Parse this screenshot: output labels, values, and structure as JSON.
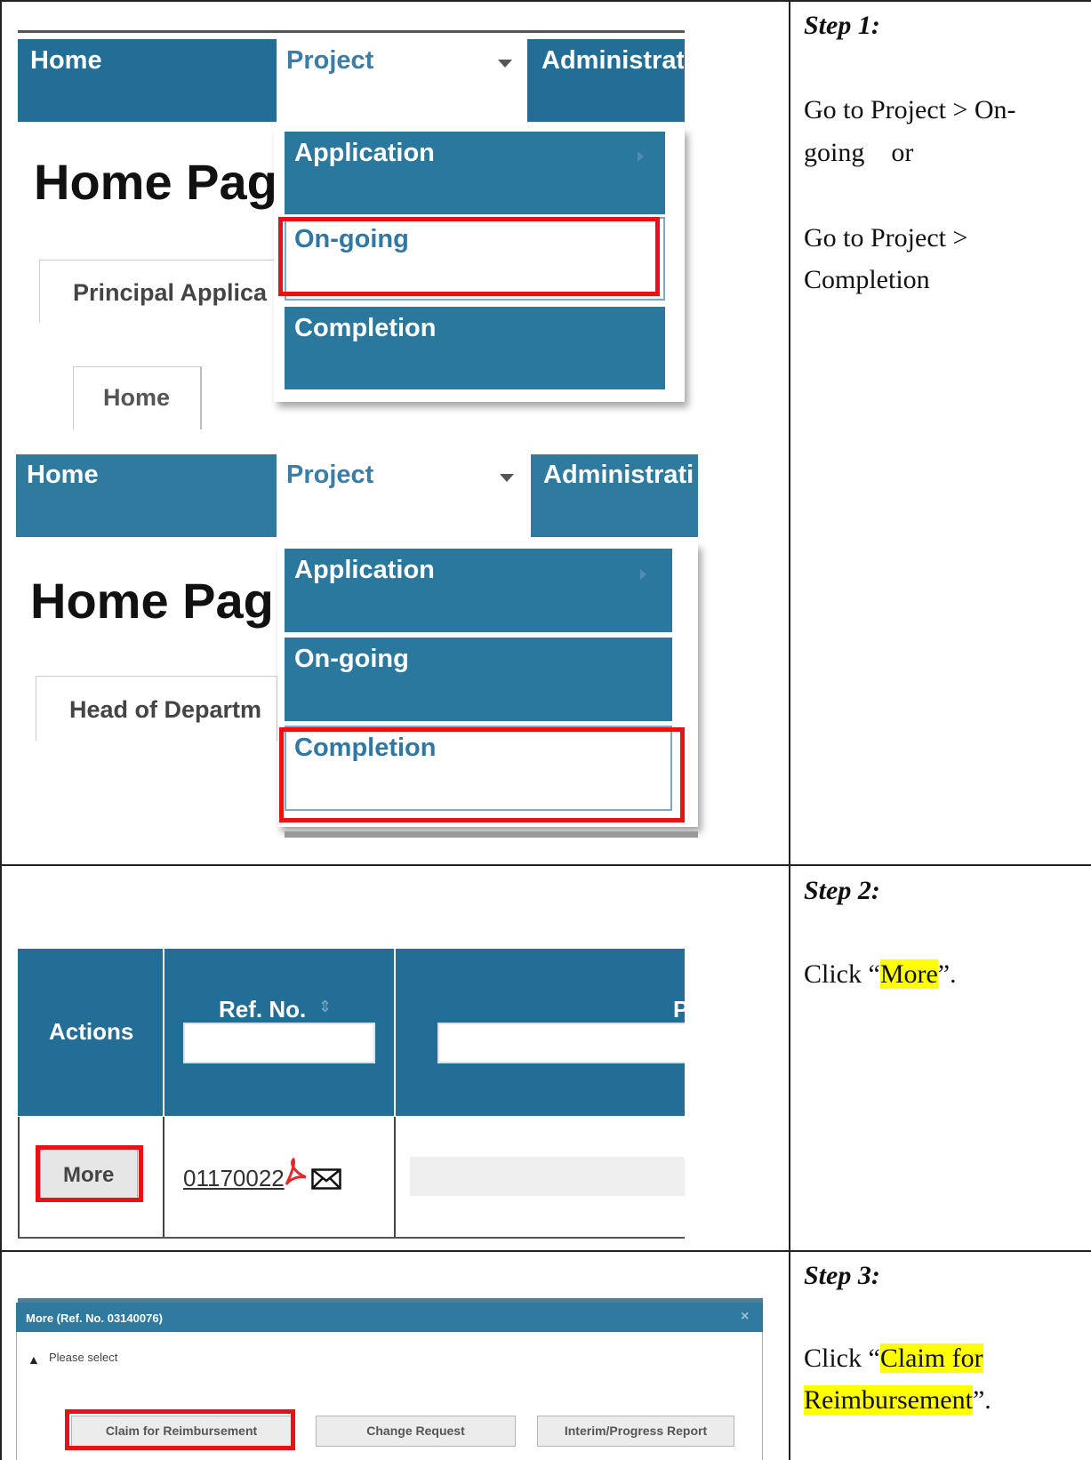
{
  "step1": {
    "title": "Step 1:",
    "line1": "Go to Project > On-",
    "line2": "going    or",
    "line3": "Go to Project >",
    "line4": "Completion",
    "shot_a": {
      "nav_home": "Home",
      "nav_project": "Project",
      "nav_admin": "Administrat",
      "page_title": "Home Pag",
      "menu_application": "Application",
      "menu_ongoing": "On-going",
      "menu_completion": "Completion",
      "tab_principal": "Principal Applica",
      "tab_home": "Home"
    },
    "shot_b": {
      "nav_home": "Home",
      "nav_project": "Project",
      "nav_admin": "Administrati",
      "page_title": "Home Pag",
      "menu_application": "Application",
      "menu_ongoing": "On-going",
      "menu_completion": "Completion",
      "tab_head": "Head of Departm"
    }
  },
  "step2": {
    "title": "Step 2:",
    "text_before": "Click “",
    "text_hl": "More",
    "text_after": "”.",
    "table": {
      "col_actions": "Actions",
      "col_ref": "Ref. No.",
      "col_p": "P",
      "more_label": "More",
      "ref_value": "01170022"
    }
  },
  "step3": {
    "title": "Step 3:",
    "text_before": "Click “",
    "text_hl_1": "Claim for",
    "text_hl_2": "Reimbursement",
    "text_after": "”.",
    "dialog": {
      "title": "More (Ref. No. 03140076)",
      "close": "×",
      "message": "Please select",
      "btn_claim": "Claim for Reimbursement",
      "btn_change": "Change Request",
      "btn_interim": "Interim/Progress Report"
    }
  }
}
